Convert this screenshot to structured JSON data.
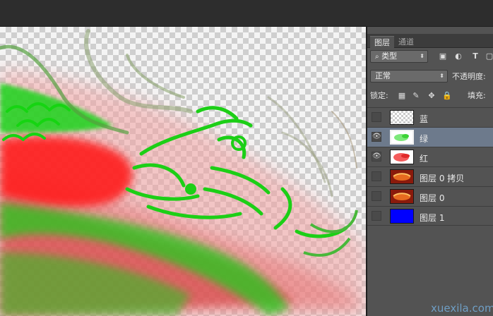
{
  "panel": {
    "tabs": [
      "图层",
      "通道"
    ],
    "filter": {
      "label": "类型"
    },
    "blend_mode": "正常",
    "opacity_label": "不透明度:",
    "lock_label": "锁定:",
    "fill_label": "填充:",
    "layers": [
      {
        "name": "蓝",
        "visible": false,
        "selected": false,
        "thumb": "checker"
      },
      {
        "name": "绿",
        "visible": true,
        "selected": true,
        "thumb": "green"
      },
      {
        "name": "红",
        "visible": true,
        "selected": false,
        "thumb": "red"
      },
      {
        "name": "图层 0 拷贝",
        "visible": false,
        "selected": false,
        "thumb": "dragon"
      },
      {
        "name": "图层 0",
        "visible": false,
        "selected": false,
        "thumb": "dragon"
      },
      {
        "name": "图层 1",
        "visible": false,
        "selected": false,
        "thumb": "blue"
      }
    ]
  },
  "watermark": "xuexila.com",
  "colors": {
    "green_channel": "#22d41c",
    "red_channel": "#ff2222",
    "blue_fill": "#0000ff"
  }
}
